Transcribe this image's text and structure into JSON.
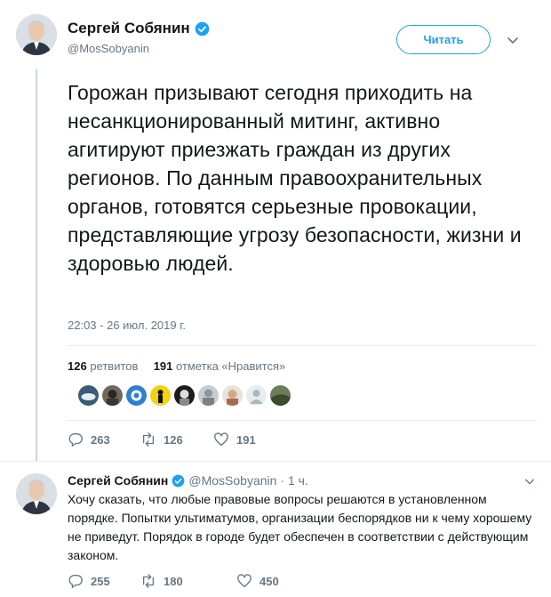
{
  "main_tweet": {
    "author_name": "Сергей Собянин",
    "handle": "@MosSobyanin",
    "follow_label": "Читать",
    "text": "Горожан призывают сегодня приходить на несанкционированный митинг, активно агитируют приезжать граждан из других регионов. По данным правоохранительных органов, готовятся серьезные провокации, представляющие угрозу безопасности, жизни и здоровью людей.",
    "timestamp": "22:03 - 26 июл. 2019 г.",
    "retweets_count": "126",
    "retweets_label": "ретвитов",
    "likes_count": "191",
    "likes_label": "отметка «Нравится»",
    "actions": {
      "replies": "263",
      "retweets": "126",
      "likes": "191"
    }
  },
  "reply_tweet": {
    "author_name": "Сергей Собянин",
    "handle": "@MosSobyanin",
    "time_ago": "· 1 ч.",
    "text": "Хочу сказать, что любые правовые вопросы решаются в установленном порядке. Попытки ультиматумов, организации беспорядков ни к чему хорошему не приведут. Порядок в городе будет обеспечен в соответствии с действующим законом.",
    "actions": {
      "replies": "255",
      "retweets": "180",
      "likes": "450"
    }
  },
  "colors": {
    "accent": "#1da1f2",
    "secondary_text": "#657786",
    "divider": "#e6ecf0"
  },
  "icons": [
    "verified-badge-icon",
    "chevron-down-icon",
    "reply-icon",
    "retweet-icon",
    "like-icon"
  ]
}
